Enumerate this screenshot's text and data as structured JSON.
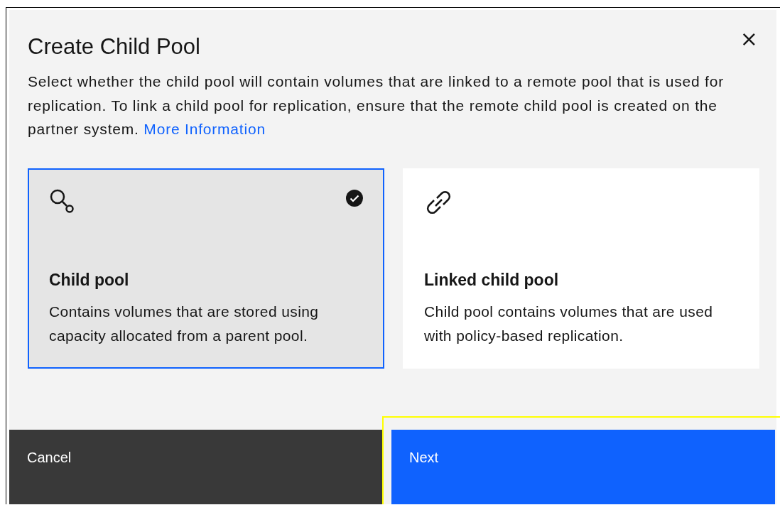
{
  "dialog": {
    "title": "Create Child Pool",
    "close_label": "×",
    "description": "Select whether the child pool will contain volumes that are linked to a remote pool that is used for replication. To link a child pool for replication, ensure that the remote child pool is created on the partner system.",
    "link": "More Information"
  },
  "options": [
    {
      "kind": "child",
      "title": "Child pool",
      "description": "Contains volumes that are stored using capacity allocated from a parent pool.",
      "selected": true
    },
    {
      "kind": "linked",
      "title": "Linked child pool",
      "description": "Child pool contains volumes that are used with policy-based replication.",
      "selected": false
    }
  ],
  "buttons": [
    {
      "kind": "secondary",
      "label": "Cancel",
      "highlighted": false
    },
    {
      "kind": "primary",
      "label": "Next",
      "highlighted": true
    }
  ]
}
